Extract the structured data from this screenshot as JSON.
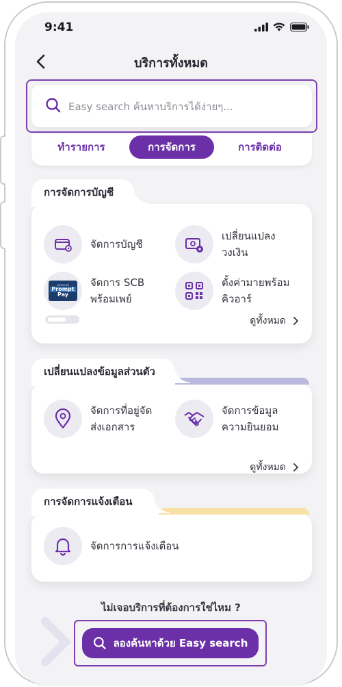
{
  "status": {
    "time": "9:41"
  },
  "header": {
    "title": "บริการทั้งหมด"
  },
  "search": {
    "placeholder": "Easy search ค้นหาบริการได้ง่ายๆ..."
  },
  "tabs": [
    {
      "label": "ทำรายการ",
      "active": false
    },
    {
      "label": "การจัดการ",
      "active": true
    },
    {
      "label": "การติดต่อ",
      "active": false
    }
  ],
  "sections": [
    {
      "title": "การจัดการบัญชี",
      "items": [
        {
          "label": "จัดการบัญชี",
          "icon": "account-card-icon"
        },
        {
          "label": "เปลี่ยนแปลง\nวงเงิน",
          "icon": "money-settings-icon"
        },
        {
          "label": "จัดการ SCB\nพร้อมเพย์",
          "icon": "promptpay-logo-icon"
        },
        {
          "label": "ตั้งค่ามายพร้อม\nคิวอาร์",
          "icon": "qr-code-icon"
        }
      ],
      "see_all": "ดูทั้งหมด",
      "accent_color": ""
    },
    {
      "title": "เปลี่ยนแปลงข้อมูลส่วนตัว",
      "items": [
        {
          "label": "จัดการที่อยู่จัด\nส่งเอกสาร",
          "icon": "location-pin-icon"
        },
        {
          "label": "จัดการข้อมูล\nความยินยอม",
          "icon": "handshake-icon"
        }
      ],
      "see_all": "ดูทั้งหมด",
      "accent_color": "#b9b8dd"
    },
    {
      "title": "การจัดการแจ้งเตือน",
      "items": [
        {
          "label": "จัดการการแจ้งเตือน",
          "icon": "bell-icon"
        }
      ],
      "accent_color": "#f8e0a6"
    }
  ],
  "promptpay_logo_text": {
    "top": "powered",
    "main": "Prompt",
    "sub": "Pay"
  },
  "footer": {
    "not_found": "ไม่เจอบริการที่ต้องการใช่ไหม ?",
    "cta_label": "ลองค้นหาด้วย Easy search"
  },
  "colors": {
    "brand": "#6b2fa8",
    "highlight_frame": "#7b3fae",
    "background": "#f3f3f5"
  }
}
